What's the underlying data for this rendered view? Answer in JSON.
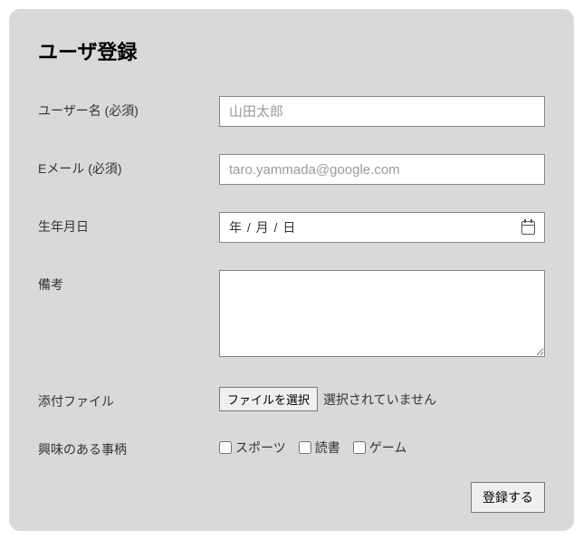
{
  "title": "ユーザ登録",
  "fields": {
    "username": {
      "label": "ユーザー名 (必須)",
      "placeholder": "山田太郎"
    },
    "email": {
      "label": "Eメール (必須)",
      "placeholder": "taro.yammada@google.com"
    },
    "birth": {
      "label": "生年月日",
      "display": "年  / 月 / 日"
    },
    "notes": {
      "label": "備考"
    },
    "attach": {
      "label": "添付ファイル",
      "button": "ファイルを選択",
      "status": "選択されていません"
    },
    "interests": {
      "label": "興味のある事柄",
      "opts": {
        "sports": "スポーツ",
        "reading": "読書",
        "game": "ゲーム"
      }
    }
  },
  "submit": "登録する"
}
